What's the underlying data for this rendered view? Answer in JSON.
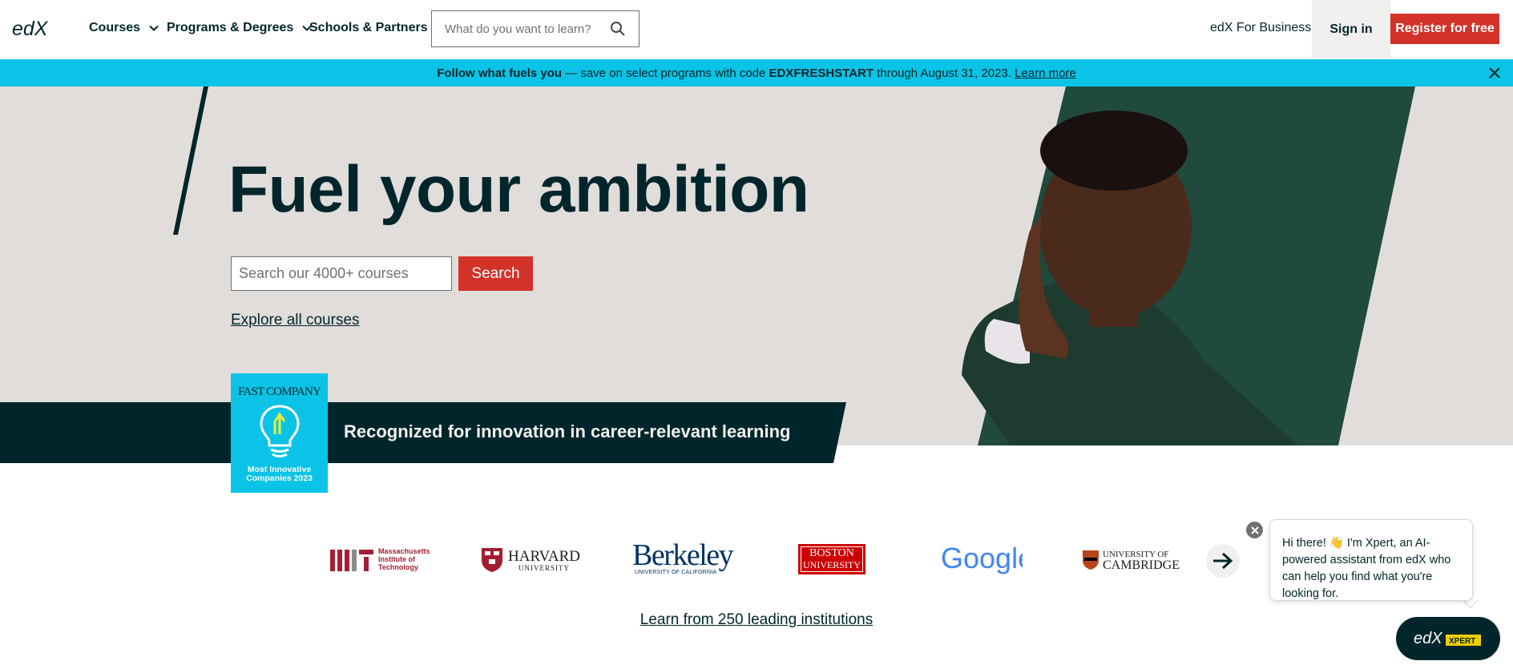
{
  "header": {
    "logo_text": "edX",
    "nav": [
      {
        "label": "Courses"
      },
      {
        "label": "Programs & Degrees"
      },
      {
        "label": "Schools & Partners"
      }
    ],
    "search_placeholder": "What do you want to learn?",
    "business_link": "edX For Business",
    "signin": "Sign in",
    "register": "Register for free"
  },
  "promo": {
    "lead": "Follow what fuels you",
    "middle": " — save on select programs with code ",
    "code": "EDXFRESHSTART",
    "tail": " through August 31, 2023. ",
    "link": "Learn more"
  },
  "hero": {
    "title": "Fuel your ambition",
    "search_placeholder": "Search our 4000+ courses",
    "search_button": "Search",
    "explore_link": "Explore all courses"
  },
  "recognition": {
    "text": "Recognized for innovation in career-relevant learning",
    "badge_title": "FAST COMPANY",
    "badge_line1": "Most Innovative",
    "badge_line2": "Companies 2023"
  },
  "partners": {
    "mit_text_1": "Massachusetts",
    "mit_text_2": "Institute of",
    "mit_text_3": "Technology",
    "harvard_1": "HARVARD",
    "harvard_2": "UNIVERSITY",
    "berkeley_1": "Berkeley",
    "berkeley_2": "UNIVERSITY OF CALIFORNIA",
    "bu_1": "BOSTON",
    "bu_2": "UNIVERSITY",
    "google": "Google",
    "cambridge_1": "UNIVERSITY OF",
    "cambridge_2": "CAMBRIDGE",
    "learn_link": "Learn from 250 leading institutions"
  },
  "chat": {
    "message": "Hi there! 👋 I'm Xpert, an AI-powered assistant from edX who can help you find what you're looking for.",
    "button_logo": "edX",
    "button_tag": "XPERT"
  },
  "colors": {
    "brand_dark": "#00262b",
    "brand_red": "#d23228",
    "banner_cyan": "#0bc3e6",
    "hero_bg": "#e1dddb",
    "hero_green": "#1f4a3d"
  }
}
